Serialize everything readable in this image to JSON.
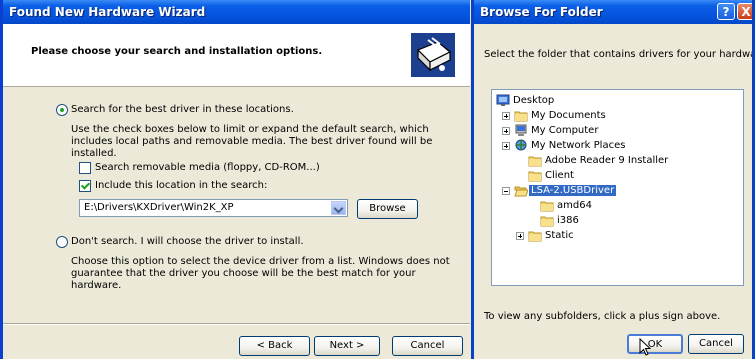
{
  "wizard": {
    "title": "Found New Hardware Wizard",
    "heading": "Please choose your search and installation options.",
    "options": {
      "search_best": {
        "label": "Search for the best driver in these locations.",
        "description": "Use the check boxes below to limit or expand the default search, which includes local paths and removable media. The best driver found will be installed.",
        "selected": true
      },
      "removable_media": {
        "label": "Search removable media (floppy, CD-ROM...)",
        "checked": false
      },
      "include_location": {
        "label": "Include this location in the search:",
        "checked": true
      },
      "location_value": "E:\\Drivers\\KXDriver\\Win2K_XP",
      "browse_label": "Browse",
      "dont_search": {
        "label": "Don't search. I will choose the driver to install.",
        "description": "Choose this option to select the device driver from a list. Windows does not guarantee that the driver you choose will be the best match for your hardware.",
        "selected": false
      }
    },
    "buttons": {
      "back": "< Back",
      "next": "Next >",
      "cancel": "Cancel"
    }
  },
  "browse_dialog": {
    "title": "Browse For Folder",
    "help_glyph": "?",
    "close_glyph": "X",
    "instruction": "Select the folder that contains drivers for your hardware.",
    "tree": [
      {
        "label": "Desktop",
        "icon": "desktop-icon"
      },
      {
        "label": "My Documents",
        "icon": "folder-icon",
        "expander": "plus"
      },
      {
        "label": "My Computer",
        "icon": "computer-icon",
        "expander": "plus"
      },
      {
        "label": "My Network Places",
        "icon": "network-icon",
        "expander": "plus"
      },
      {
        "label": "Adobe Reader 9 Installer",
        "icon": "folder-icon"
      },
      {
        "label": "Client",
        "icon": "folder-icon"
      },
      {
        "label": "LSA-2.USBDriver",
        "icon": "open-folder-icon",
        "expander": "minus",
        "selected": true
      },
      {
        "label": "amd64",
        "icon": "folder-icon"
      },
      {
        "label": "i386",
        "icon": "folder-icon"
      },
      {
        "label": "Static",
        "icon": "folder-icon",
        "expander": "plus"
      }
    ],
    "hint": "To view any subfolders, click a plus sign above.",
    "buttons": {
      "ok": "OK",
      "cancel": "Cancel"
    }
  },
  "colors": {
    "titlebar": "#0553dd",
    "selection": "#316ac5",
    "window_body": "#ece9d8",
    "close_button": "#c83d18"
  }
}
